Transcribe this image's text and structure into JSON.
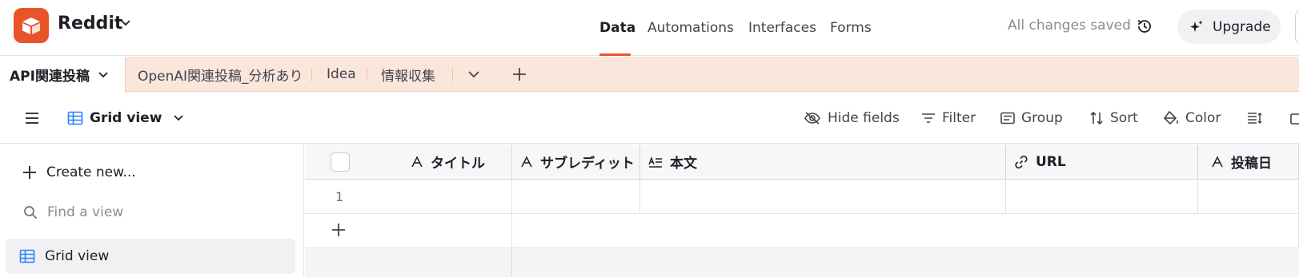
{
  "header": {
    "base_name": "Reddit",
    "nav": [
      "Data",
      "Automations",
      "Interfaces",
      "Forms"
    ],
    "status": "All changes saved",
    "upgrade_label": "Upgrade",
    "accent_color": "#e8542a"
  },
  "tables": {
    "active": "API関連投稿",
    "others": [
      "OpenAI関連投稿_分析あり",
      "Idea",
      "情報収集"
    ]
  },
  "viewbar": {
    "view_name": "Grid view",
    "tools": [
      "Hide fields",
      "Filter",
      "Group",
      "Sort",
      "Color"
    ]
  },
  "sidebar": {
    "create_label": "Create new...",
    "find_placeholder": "Find a view",
    "views": [
      "Grid view"
    ]
  },
  "grid": {
    "columns": [
      {
        "name": "タイトル",
        "icon": "text-icon"
      },
      {
        "name": "サブレディット",
        "icon": "text-icon"
      },
      {
        "name": "本文",
        "icon": "long-text-icon"
      },
      {
        "name": "URL",
        "icon": "link-icon"
      },
      {
        "name": "投稿日",
        "icon": "text-icon"
      }
    ],
    "rows": [
      "1"
    ]
  }
}
